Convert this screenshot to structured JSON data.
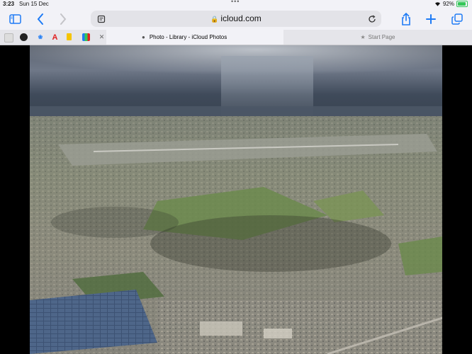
{
  "status_bar": {
    "time": "3:23",
    "date": "Sun 15 Dec",
    "battery_percent": "92%",
    "battery_level": 0.92
  },
  "toolbar": {
    "address": "icloud.com",
    "icons": [
      "sidebar-icon",
      "back-icon",
      "forward-icon",
      "reader-icon",
      "reload-icon",
      "share-icon",
      "new-tab-icon",
      "tabs-overview-icon"
    ]
  },
  "tabs": {
    "active_title": "Photo - Library - iCloud Photos",
    "inactive_title": "Start Page"
  },
  "colors": {
    "accent": "#1e7bf5",
    "chrome": "#f2f2f7"
  }
}
